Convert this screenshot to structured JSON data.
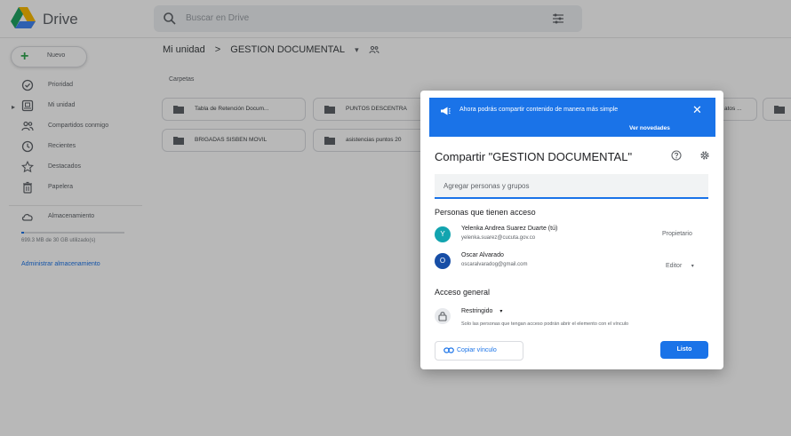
{
  "header": {
    "app_name": "Drive",
    "search_placeholder": "Buscar en Drive"
  },
  "sidebar": {
    "new_label": "Nuevo",
    "items": [
      {
        "label": "Prioridad",
        "icon": "check-circle-icon"
      },
      {
        "label": "Mi unidad",
        "icon": "drive-icon"
      },
      {
        "label": "Compartidos conmigo",
        "icon": "people-icon"
      },
      {
        "label": "Recientes",
        "icon": "clock-icon"
      },
      {
        "label": "Destacados",
        "icon": "star-icon"
      },
      {
        "label": "Papelera",
        "icon": "trash-icon"
      },
      {
        "label": "Almacenamiento",
        "icon": "cloud-icon"
      }
    ],
    "storage_used": "699.3 MB de 30 GB utilizado(s)",
    "manage_storage": "Administrar almacenamiento"
  },
  "main": {
    "breadcrumb": [
      "Mi unidad",
      ">",
      "GESTION DOCUMENTAL",
      "▾"
    ],
    "section_label": "Carpetas",
    "folders": [
      "Tabla de Retención Docum...",
      "PUNTOS DESCENTRA",
      "atos ...",
      "BRIGADAS SISBEN MOVIL",
      "asistencias puntos 20"
    ]
  },
  "dialog": {
    "banner_text": "Ahora podrás compartir contenido de manera más simple",
    "banner_link": "Ver novedades",
    "title": "Compartir \"GESTION DOCUMENTAL\"",
    "add_placeholder": "Agregar personas y grupos",
    "people_heading": "Personas que tienen acceso",
    "people": [
      {
        "initial": "Y",
        "name": "Yelenka Andrea Suarez Duarte (tú)",
        "email": "yelenka.suarez@cucuta.gov.co",
        "role": "Propietario",
        "color": "#12a4af"
      },
      {
        "initial": "O",
        "name": "Oscar Alvarado",
        "email": "oscaralvaradog@gmail.com",
        "role": "Editor",
        "color": "#174ea6"
      }
    ],
    "role_caret": "▾",
    "general_heading": "Acceso general",
    "access_mode": "Restringido",
    "access_desc": "Solo las personas que tengan acceso podrán abrir el elemento con el vínculo",
    "copy_link": "Copiar vínculo",
    "done": "Listo"
  },
  "colors": {
    "accent": "#1a73e8"
  }
}
